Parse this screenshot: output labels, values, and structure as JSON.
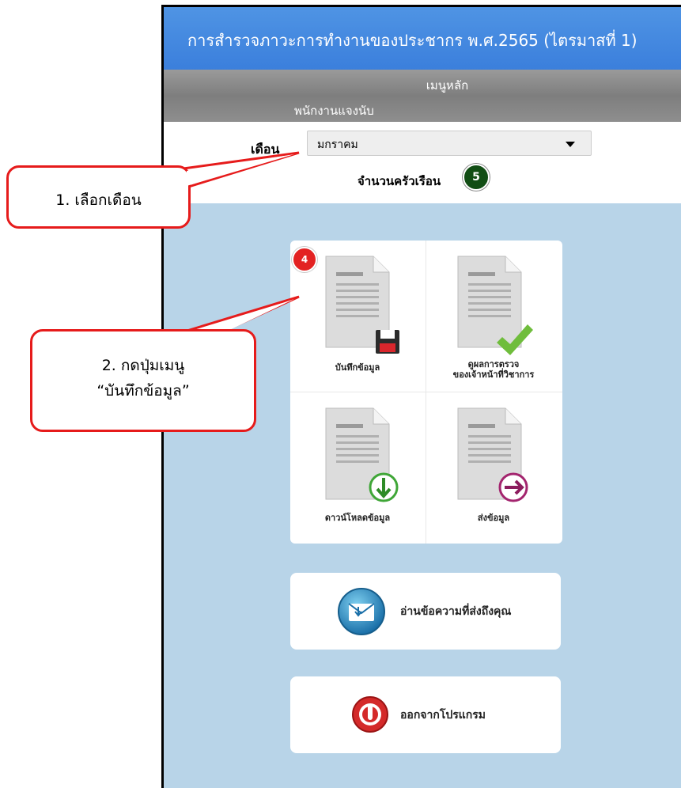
{
  "app": {
    "title": "การสำรวจภาวะการทำงานของประชากร พ.ศ.2565 (ไตรมาสที่ 1)",
    "menu_label": "เมนูหลัก",
    "staff_label": "พนักงานแจงนับ"
  },
  "month_select": {
    "label": "เดือน",
    "value": "มกราคม"
  },
  "households": {
    "label": "จำนวนครัวเรือน",
    "count": "5"
  },
  "menu": {
    "record_badge": "4",
    "items": [
      {
        "label": "บันทึกข้อมูล"
      },
      {
        "label_line1": "ดูผลการตรวจ",
        "label_line2": "ของเจ้าหน้าที่วิชาการ"
      },
      {
        "label": "ดาวน์โหลดข้อมูล"
      },
      {
        "label": "ส่งข้อมูล"
      }
    ],
    "read_messages": "อ่านข้อความที่ส่งถึงคุณ",
    "exit": "ออกจากโปรแกรม"
  },
  "callouts": {
    "step1": "1. เลือกเดือน",
    "step2_line1": "2. กดปุ่มเมนู",
    "step2_line2": "“บันทึกข้อมูล”"
  },
  "colors": {
    "title_bar": "#3b7fdc",
    "callout_border": "#e61b1b",
    "content_bg": "#b8d4e8"
  }
}
